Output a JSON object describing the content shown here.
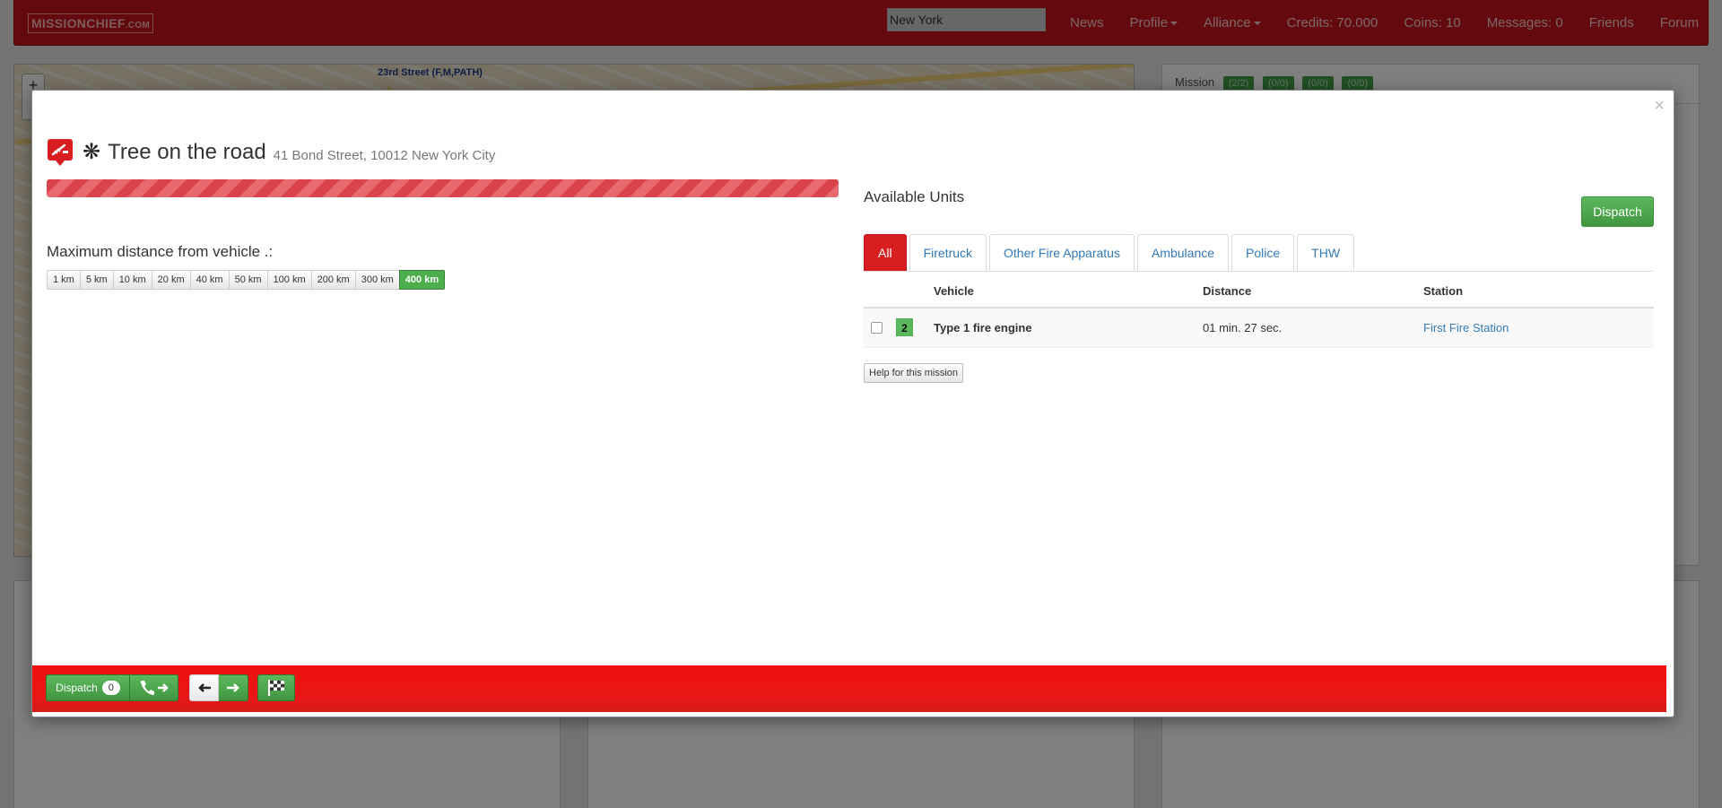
{
  "navbar": {
    "brand": "MISSIONCHIEF",
    "brand_suffix": ".COM",
    "search_value": "New York",
    "links": {
      "news": "News",
      "profile": "Profile",
      "alliance": "Alliance",
      "credits": "Credits: 70.000",
      "coins": "Coins: 10",
      "messages": "Messages: 0",
      "friends": "Friends",
      "forum": "Forum"
    }
  },
  "background": {
    "map_zoom_in": "+",
    "map_street_label": "23rd Street (F,M,PATH)",
    "side_panel_title": "Mission",
    "side_panel_pills": [
      "(2/2)",
      "(0/0)",
      "(0/0)",
      "(0/0)"
    ]
  },
  "mission": {
    "close": "×",
    "icon": "tree-cut-icon",
    "status_glyph": "❋",
    "title": "Tree on the road",
    "address": "41 Bond Street, 10012 New York City",
    "progress_percent": 100,
    "progress_color": "#d9434a"
  },
  "distance": {
    "label": "Maximum distance from vehicle .:",
    "options": [
      "1 km",
      "5 km",
      "10 km",
      "20 km",
      "40 km",
      "50 km",
      "100 km",
      "200 km",
      "300 km",
      "400 km"
    ],
    "selected": "400 km"
  },
  "units": {
    "title": "Available Units",
    "dispatch_label": "Dispatch",
    "tabs": [
      "All",
      "Firetruck",
      "Other Fire Apparatus",
      "Ambulance",
      "Police",
      "THW"
    ],
    "active_tab": "All",
    "columns": [
      "Vehicle",
      "Distance",
      "Station"
    ],
    "rows": [
      {
        "count": "2",
        "vehicle": "Type 1 fire engine",
        "distance": "01 min. 27 sec.",
        "station": "First Fire Station"
      }
    ],
    "help_label": "Help for this mission"
  },
  "action_bar": {
    "dispatch_label": "Dispatch",
    "dispatch_count": "0",
    "icons": [
      "phone-forward-icon",
      "arrow-left-icon",
      "arrow-right-icon",
      "checkered-flag-icon"
    ]
  },
  "colors": {
    "navbar": "#c9141c",
    "action_bar": "#e81616",
    "accent_green": "#5cb85c",
    "link_blue": "#337ab7",
    "active_tab": "#d81e1e"
  }
}
